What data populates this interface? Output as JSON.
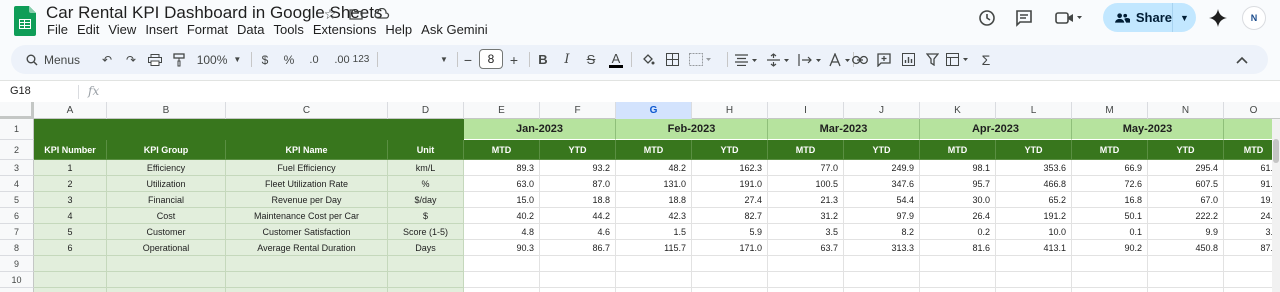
{
  "app": {
    "title": "Car Rental KPI Dashboard in Google Sheets",
    "menu": [
      "File",
      "Edit",
      "View",
      "Insert",
      "Format",
      "Data",
      "Tools",
      "Extensions",
      "Help",
      "Ask Gemini"
    ],
    "share_label": "Share",
    "avatar_initials": "N"
  },
  "toolbar": {
    "menus_label": "Menus",
    "zoom": "100%",
    "currency": "$",
    "percent": "%",
    "decrease_decimals": ".0",
    "increase_decimals": ".00",
    "number_format": "123",
    "font_size": "8"
  },
  "formula_bar": {
    "cell_ref": "G18",
    "fx": "fx",
    "value": ""
  },
  "sheet": {
    "selected_column": "G",
    "columns": [
      "A",
      "B",
      "C",
      "D",
      "E",
      "F",
      "G",
      "H",
      "I",
      "J",
      "K",
      "L",
      "M",
      "N",
      "O"
    ],
    "rows": [
      "1",
      "2",
      "3",
      "4",
      "5",
      "6",
      "7",
      "8",
      "9",
      "10",
      "11"
    ],
    "headers": [
      "KPI Number",
      "KPI Group",
      "KPI Name",
      "Unit"
    ],
    "months": [
      "Jan-2023",
      "Feb-2023",
      "Mar-2023",
      "Apr-2023",
      "May-2023"
    ],
    "subheaders": [
      "MTD",
      "YTD",
      "MTD",
      "YTD",
      "MTD",
      "YTD",
      "MTD",
      "YTD",
      "MTD",
      "YTD",
      "MTD"
    ],
    "kpis": [
      {
        "num": "1",
        "group": "Efficiency",
        "name": "Fuel Efficiency",
        "unit": "km/L",
        "values": [
          "89.3",
          "93.2",
          "48.2",
          "162.3",
          "77.0",
          "249.9",
          "98.1",
          "353.6",
          "66.9",
          "295.4",
          "61.8"
        ]
      },
      {
        "num": "2",
        "group": "Utilization",
        "name": "Fleet Utilization Rate",
        "unit": "%",
        "values": [
          "63.0",
          "87.0",
          "131.0",
          "191.0",
          "100.5",
          "347.6",
          "95.7",
          "466.8",
          "72.6",
          "607.5",
          "91.5"
        ]
      },
      {
        "num": "3",
        "group": "Financial",
        "name": "Revenue per Day",
        "unit": "$/day",
        "values": [
          "15.0",
          "18.8",
          "18.8",
          "27.4",
          "21.3",
          "54.4",
          "30.0",
          "65.2",
          "16.8",
          "67.0",
          "19.0"
        ]
      },
      {
        "num": "4",
        "group": "Cost",
        "name": "Maintenance Cost per Car",
        "unit": "$",
        "values": [
          "40.2",
          "44.2",
          "42.3",
          "82.7",
          "31.2",
          "97.9",
          "26.4",
          "191.2",
          "50.1",
          "222.2",
          "24.2"
        ]
      },
      {
        "num": "5",
        "group": "Customer",
        "name": "Customer Satisfaction",
        "unit": "Score (1-5)",
        "values": [
          "4.8",
          "4.6",
          "1.5",
          "5.9",
          "3.5",
          "8.2",
          "0.2",
          "10.0",
          "0.1",
          "9.9",
          "3.3"
        ]
      },
      {
        "num": "6",
        "group": "Operational",
        "name": "Average Rental Duration",
        "unit": "Days",
        "values": [
          "90.3",
          "86.7",
          "115.7",
          "171.0",
          "63.7",
          "313.3",
          "81.6",
          "413.1",
          "90.2",
          "450.8",
          "87.6"
        ]
      }
    ]
  },
  "colors": {
    "header_dark_green": "#38761d",
    "month_light_green": "#b6e39e",
    "kpi_body_green": "#e2eedc",
    "share_button": "#c2e7ff"
  }
}
